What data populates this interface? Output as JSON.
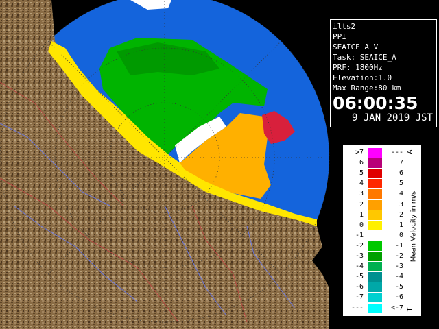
{
  "info": {
    "site": "ilts2",
    "product": "PPI",
    "name": "SEAICE_A_V",
    "task": "Task: SEAICE_A",
    "prf": "PRF: 1800Hz",
    "elevation": "Elevation:1.0",
    "range": "Max Range:80 km",
    "time": "06:00:35",
    "date": "9 JAN 2019 JST"
  },
  "legend": {
    "title": "Mean Velocity in m/s",
    "top_marker": "A",
    "bottom_marker": "T",
    "rows": [
      {
        "left": ">7",
        "right": "---",
        "color": "#ff00ff"
      },
      {
        "left": "6",
        "right": "7",
        "color": "#b80078"
      },
      {
        "left": "5",
        "right": "6",
        "color": "#e00000"
      },
      {
        "left": "4",
        "right": "5",
        "color": "#ff2800"
      },
      {
        "left": "3",
        "right": "4",
        "color": "#ff7800"
      },
      {
        "left": "2",
        "right": "3",
        "color": "#ffa000"
      },
      {
        "left": "1",
        "right": "2",
        "color": "#ffc800"
      },
      {
        "left": "0",
        "right": "1",
        "color": "#fff000"
      },
      {
        "left": "-1",
        "right": "0",
        "color": "#ffffff"
      },
      {
        "left": "-2",
        "right": "-1",
        "color": "#00c800"
      },
      {
        "left": "-3",
        "right": "-2",
        "color": "#00a000"
      },
      {
        "left": "-4",
        "right": "-3",
        "color": "#00b050"
      },
      {
        "left": "-5",
        "right": "-4",
        "color": "#009090"
      },
      {
        "left": "-6",
        "right": "-5",
        "color": "#00a8a8"
      },
      {
        "left": "-7",
        "right": "-6",
        "color": "#00d0d0"
      },
      {
        "left": "---",
        "right": "<-7",
        "color": "#00ffff"
      }
    ]
  },
  "colors": {
    "sea": "#1464dc",
    "land": "#8a6a40",
    "coast": "#ffe600",
    "approach": "#00b400",
    "recede": "#ffa800"
  }
}
